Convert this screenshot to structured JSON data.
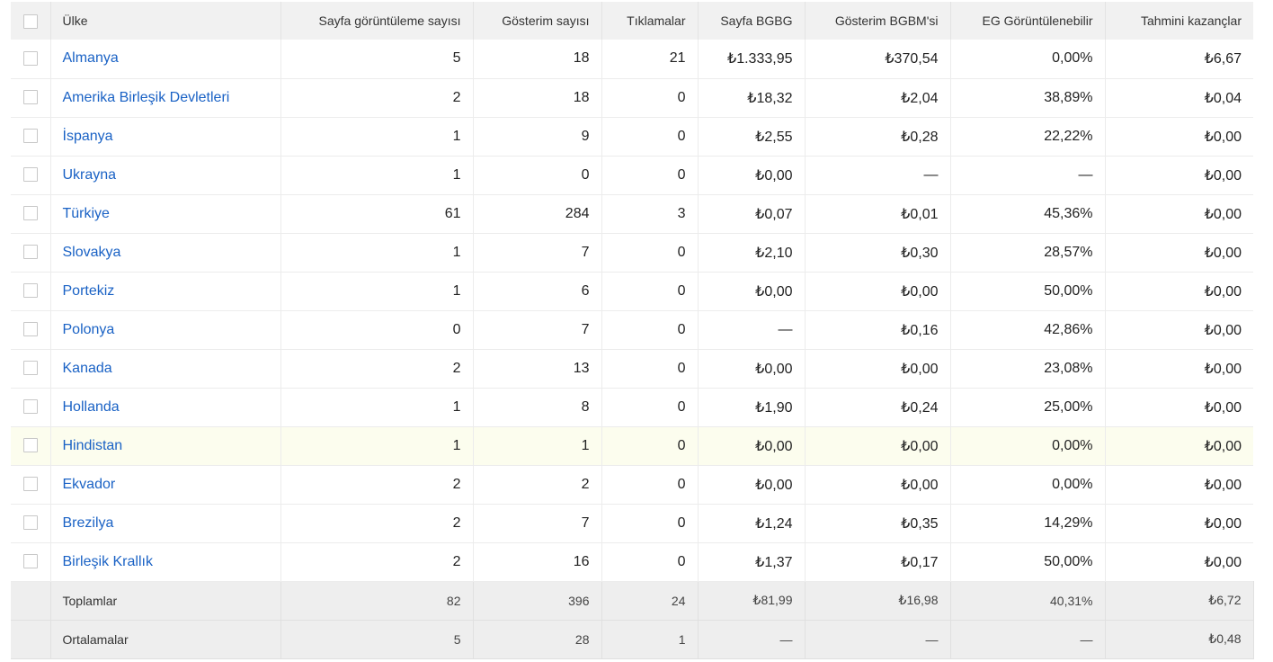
{
  "header": {
    "country": "Ülke",
    "page_views": "Sayfa görüntüleme sayısı",
    "impressions": "Gösterim sayısı",
    "clicks": "Tıklamalar",
    "page_rpm": "Sayfa BGBG",
    "impression_rpm": "Gösterim BGBM'si",
    "viewability": "EG Görüntülenebilir",
    "earnings": "Tahmini kazançlar"
  },
  "rows": [
    {
      "country": "Almanya",
      "page_views": "5",
      "impressions": "18",
      "clicks": "21",
      "page_rpm": "₺1.333,95",
      "impression_rpm": "₺370,54",
      "viewability": "0,00%",
      "earnings": "₺6,67"
    },
    {
      "country": "Amerika Birleşik Devletleri",
      "page_views": "2",
      "impressions": "18",
      "clicks": "0",
      "page_rpm": "₺18,32",
      "impression_rpm": "₺2,04",
      "viewability": "38,89%",
      "earnings": "₺0,04"
    },
    {
      "country": "İspanya",
      "page_views": "1",
      "impressions": "9",
      "clicks": "0",
      "page_rpm": "₺2,55",
      "impression_rpm": "₺0,28",
      "viewability": "22,22%",
      "earnings": "₺0,00"
    },
    {
      "country": "Ukrayna",
      "page_views": "1",
      "impressions": "0",
      "clicks": "0",
      "page_rpm": "₺0,00",
      "impression_rpm": "—",
      "viewability": "—",
      "earnings": "₺0,00"
    },
    {
      "country": "Türkiye",
      "page_views": "61",
      "impressions": "284",
      "clicks": "3",
      "page_rpm": "₺0,07",
      "impression_rpm": "₺0,01",
      "viewability": "45,36%",
      "earnings": "₺0,00"
    },
    {
      "country": "Slovakya",
      "page_views": "1",
      "impressions": "7",
      "clicks": "0",
      "page_rpm": "₺2,10",
      "impression_rpm": "₺0,30",
      "viewability": "28,57%",
      "earnings": "₺0,00"
    },
    {
      "country": "Portekiz",
      "page_views": "1",
      "impressions": "6",
      "clicks": "0",
      "page_rpm": "₺0,00",
      "impression_rpm": "₺0,00",
      "viewability": "50,00%",
      "earnings": "₺0,00"
    },
    {
      "country": "Polonya",
      "page_views": "0",
      "impressions": "7",
      "clicks": "0",
      "page_rpm": "—",
      "impression_rpm": "₺0,16",
      "viewability": "42,86%",
      "earnings": "₺0,00"
    },
    {
      "country": "Kanada",
      "page_views": "2",
      "impressions": "13",
      "clicks": "0",
      "page_rpm": "₺0,00",
      "impression_rpm": "₺0,00",
      "viewability": "23,08%",
      "earnings": "₺0,00"
    },
    {
      "country": "Hollanda",
      "page_views": "1",
      "impressions": "8",
      "clicks": "0",
      "page_rpm": "₺1,90",
      "impression_rpm": "₺0,24",
      "viewability": "25,00%",
      "earnings": "₺0,00"
    },
    {
      "country": "Hindistan",
      "page_views": "1",
      "impressions": "1",
      "clicks": "0",
      "page_rpm": "₺0,00",
      "impression_rpm": "₺0,00",
      "viewability": "0,00%",
      "earnings": "₺0,00"
    },
    {
      "country": "Ekvador",
      "page_views": "2",
      "impressions": "2",
      "clicks": "0",
      "page_rpm": "₺0,00",
      "impression_rpm": "₺0,00",
      "viewability": "0,00%",
      "earnings": "₺0,00"
    },
    {
      "country": "Brezilya",
      "page_views": "2",
      "impressions": "7",
      "clicks": "0",
      "page_rpm": "₺1,24",
      "impression_rpm": "₺0,35",
      "viewability": "14,29%",
      "earnings": "₺0,00"
    },
    {
      "country": "Birleşik Krallık",
      "page_views": "2",
      "impressions": "16",
      "clicks": "0",
      "page_rpm": "₺1,37",
      "impression_rpm": "₺0,17",
      "viewability": "50,00%",
      "earnings": "₺0,00"
    }
  ],
  "totals": {
    "label": "Toplamlar",
    "page_views": "82",
    "impressions": "396",
    "clicks": "24",
    "page_rpm": "₺81,99",
    "impression_rpm": "₺16,98",
    "viewability": "40,31%",
    "earnings": "₺6,72"
  },
  "averages": {
    "label": "Ortalamalar",
    "page_views": "5",
    "impressions": "28",
    "clicks": "1",
    "page_rpm": "—",
    "impression_rpm": "—",
    "viewability": "—",
    "earnings": "₺0,48"
  }
}
